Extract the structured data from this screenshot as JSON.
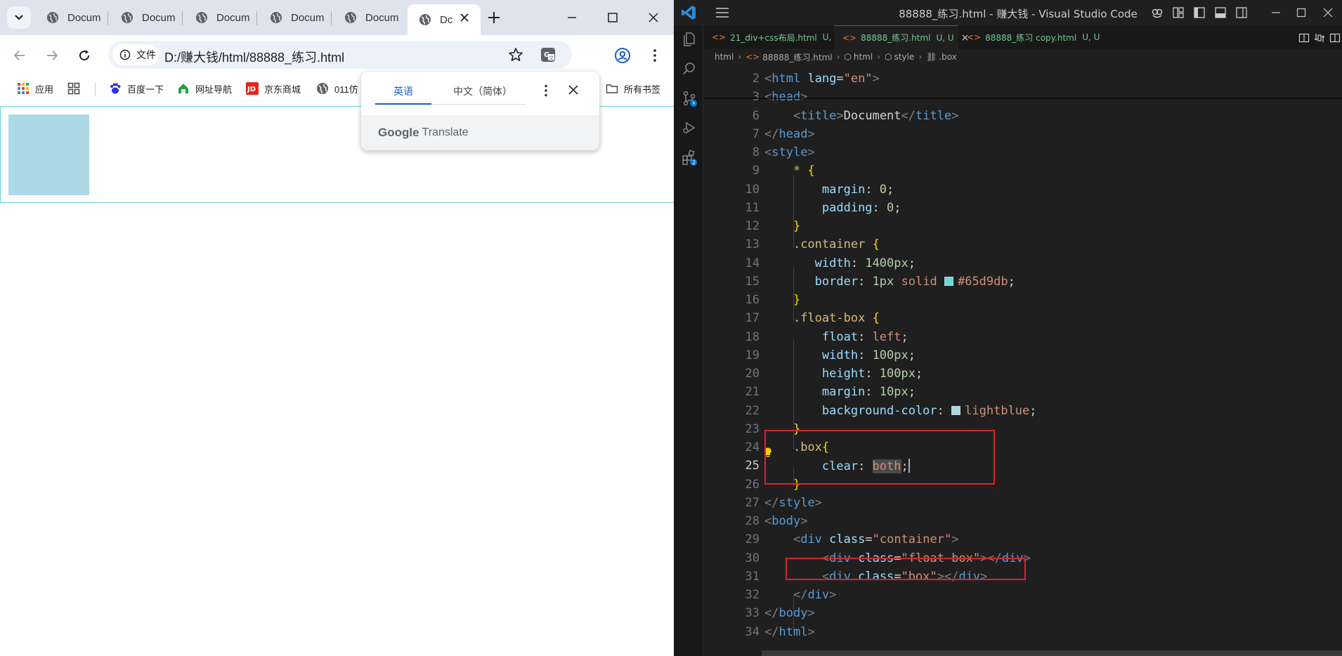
{
  "browser": {
    "tabs": [
      {
        "label": "Docum"
      },
      {
        "label": "Docum"
      },
      {
        "label": "Docum"
      },
      {
        "label": "Docum"
      },
      {
        "label": "Docum"
      },
      {
        "label": "Dc",
        "active": true
      }
    ],
    "address": {
      "chip_label": "文件",
      "url": "D:/赚大钱/html/88888_练习.html"
    },
    "bookmarks": [
      {
        "label": "应用",
        "icon": "apps-grid-icon"
      },
      {
        "label": "",
        "icon": "grid-icon"
      },
      {
        "label": "百度一下",
        "icon": "baidu-paw-icon"
      },
      {
        "label": "网址导航",
        "icon": "house-icon"
      },
      {
        "label": "京东商城",
        "icon": "jd-icon"
      },
      {
        "label": "011仿",
        "icon": "globe-icon"
      }
    ],
    "all_bookmarks": "所有书签",
    "translate_popup": {
      "tab_source": "英语",
      "tab_target": "中文（简体）",
      "brand": "Google",
      "product": "Translate"
    },
    "page": {
      "container_border_color": "#65d9db",
      "float_box_color": "#add8e6"
    }
  },
  "vscode": {
    "title": "88888_练习.html - 赚大钱 - Visual Studio Code",
    "tabs": [
      {
        "name": "21_div+css布局.html",
        "status": "U, U"
      },
      {
        "name": "88888_练习.html",
        "status": "U, U",
        "active": true
      },
      {
        "name": "88888_练习 copy.html",
        "status": "U, U"
      }
    ],
    "breadcrumb": [
      "html",
      "88888_练习.html",
      "html",
      "style",
      ".box"
    ],
    "activity_badge": "2",
    "current_line": 25,
    "lines": [
      {
        "n": 2,
        "tokens": [
          [
            "br",
            "<"
          ],
          [
            "tag",
            "html"
          ],
          [
            "txt",
            " "
          ],
          [
            "attr",
            "lang"
          ],
          [
            "punc",
            "="
          ],
          [
            "str",
            "\"en\""
          ],
          [
            "br",
            ">"
          ]
        ]
      },
      {
        "n": 3,
        "tokens": [
          [
            "br",
            "<"
          ],
          [
            "tag",
            "head"
          ],
          [
            "br",
            ">"
          ]
        ]
      },
      {
        "n": 6,
        "tokens": [
          [
            "txt",
            "    "
          ],
          [
            "br",
            "<"
          ],
          [
            "tag",
            "title"
          ],
          [
            "br",
            ">"
          ],
          [
            "txt",
            "Document"
          ],
          [
            "br",
            "</"
          ],
          [
            "tag",
            "title"
          ],
          [
            "br",
            ">"
          ]
        ]
      },
      {
        "n": 7,
        "tokens": [
          [
            "br",
            "</"
          ],
          [
            "tag",
            "head"
          ],
          [
            "br",
            ">"
          ]
        ]
      },
      {
        "n": 8,
        "tokens": [
          [
            "br",
            "<"
          ],
          [
            "tag",
            "style"
          ],
          [
            "br",
            ">"
          ]
        ]
      },
      {
        "n": 9,
        "tokens": [
          [
            "txt",
            "    "
          ],
          [
            "sel",
            "*"
          ],
          [
            "txt",
            " "
          ],
          [
            "brace",
            "{"
          ]
        ]
      },
      {
        "n": 10,
        "tokens": [
          [
            "txt",
            "        "
          ],
          [
            "prop",
            "margin"
          ],
          [
            "punc",
            ": "
          ],
          [
            "num",
            "0"
          ],
          [
            "punc",
            ";"
          ]
        ]
      },
      {
        "n": 11,
        "tokens": [
          [
            "txt",
            "        "
          ],
          [
            "prop",
            "padding"
          ],
          [
            "punc",
            ": "
          ],
          [
            "num",
            "0"
          ],
          [
            "punc",
            ";"
          ]
        ]
      },
      {
        "n": 12,
        "tokens": [
          [
            "txt",
            "    "
          ],
          [
            "brace",
            "}"
          ]
        ]
      },
      {
        "n": 13,
        "tokens": [
          [
            "txt",
            "    "
          ],
          [
            "sel",
            ".container"
          ],
          [
            "txt",
            " "
          ],
          [
            "brace",
            "{"
          ]
        ]
      },
      {
        "n": 14,
        "tokens": [
          [
            "txt",
            "       "
          ],
          [
            "prop",
            "width"
          ],
          [
            "punc",
            ": "
          ],
          [
            "num",
            "1400px"
          ],
          [
            "punc",
            ";"
          ]
        ]
      },
      {
        "n": 15,
        "tokens": [
          [
            "txt",
            "       "
          ],
          [
            "prop",
            "border"
          ],
          [
            "punc",
            ": "
          ],
          [
            "num",
            "1px"
          ],
          [
            "txt",
            " "
          ],
          [
            "val",
            "solid"
          ],
          [
            "txt",
            " "
          ],
          [
            "swatch",
            "#65d9db"
          ],
          [
            "val",
            "#65d9db"
          ],
          [
            "punc",
            ";"
          ]
        ]
      },
      {
        "n": 16,
        "tokens": [
          [
            "txt",
            "    "
          ],
          [
            "brace",
            "}"
          ]
        ]
      },
      {
        "n": 17,
        "tokens": [
          [
            "txt",
            "    "
          ],
          [
            "sel",
            ".float-box"
          ],
          [
            "txt",
            " "
          ],
          [
            "brace",
            "{"
          ]
        ]
      },
      {
        "n": 18,
        "tokens": [
          [
            "txt",
            "        "
          ],
          [
            "prop",
            "float"
          ],
          [
            "punc",
            ": "
          ],
          [
            "val",
            "left"
          ],
          [
            "punc",
            ";"
          ]
        ]
      },
      {
        "n": 19,
        "tokens": [
          [
            "txt",
            "        "
          ],
          [
            "prop",
            "width"
          ],
          [
            "punc",
            ": "
          ],
          [
            "num",
            "100px"
          ],
          [
            "punc",
            ";"
          ]
        ]
      },
      {
        "n": 20,
        "tokens": [
          [
            "txt",
            "        "
          ],
          [
            "prop",
            "height"
          ],
          [
            "punc",
            ": "
          ],
          [
            "num",
            "100px"
          ],
          [
            "punc",
            ";"
          ]
        ]
      },
      {
        "n": 21,
        "tokens": [
          [
            "txt",
            "        "
          ],
          [
            "prop",
            "margin"
          ],
          [
            "punc",
            ": "
          ],
          [
            "num",
            "10px"
          ],
          [
            "punc",
            ";"
          ]
        ]
      },
      {
        "n": 22,
        "tokens": [
          [
            "txt",
            "        "
          ],
          [
            "prop",
            "background-color"
          ],
          [
            "punc",
            ": "
          ],
          [
            "swatch",
            "#add8e6"
          ],
          [
            "val",
            "lightblue"
          ],
          [
            "punc",
            ";"
          ]
        ]
      },
      {
        "n": 23,
        "tokens": [
          [
            "txt",
            "    "
          ],
          [
            "brace",
            "}"
          ]
        ]
      },
      {
        "n": 24,
        "tokens": [
          [
            "txt",
            "    "
          ],
          [
            "sel",
            ".box"
          ],
          [
            "brace",
            "{"
          ]
        ]
      },
      {
        "n": 25,
        "tokens": [
          [
            "txt",
            "        "
          ],
          [
            "prop",
            "clear"
          ],
          [
            "punc",
            ": "
          ],
          [
            "valsel",
            "both"
          ],
          [
            "punc",
            ";"
          ],
          [
            "cursor",
            ""
          ]
        ]
      },
      {
        "n": 26,
        "tokens": [
          [
            "txt",
            "    "
          ],
          [
            "brace",
            "}"
          ]
        ]
      },
      {
        "n": 27,
        "tokens": [
          [
            "br",
            "</"
          ],
          [
            "tag",
            "style"
          ],
          [
            "br",
            ">"
          ]
        ]
      },
      {
        "n": 28,
        "tokens": [
          [
            "br",
            "<"
          ],
          [
            "tag",
            "body"
          ],
          [
            "br",
            ">"
          ]
        ]
      },
      {
        "n": 29,
        "tokens": [
          [
            "txt",
            "    "
          ],
          [
            "br",
            "<"
          ],
          [
            "tag",
            "div"
          ],
          [
            "txt",
            " "
          ],
          [
            "attr",
            "class"
          ],
          [
            "punc",
            "="
          ],
          [
            "str",
            "\"container\""
          ],
          [
            "br",
            ">"
          ]
        ]
      },
      {
        "n": 30,
        "tokens": [
          [
            "txt",
            "        "
          ],
          [
            "br",
            "<"
          ],
          [
            "tag",
            "div"
          ],
          [
            "txt",
            " "
          ],
          [
            "attr",
            "class"
          ],
          [
            "punc",
            "="
          ],
          [
            "str",
            "\"float-box\""
          ],
          [
            "br",
            "></"
          ],
          [
            "tag",
            "div"
          ],
          [
            "br",
            ">"
          ]
        ]
      },
      {
        "n": 31,
        "tokens": [
          [
            "txt",
            "        "
          ],
          [
            "br",
            "<"
          ],
          [
            "tag",
            "div"
          ],
          [
            "txt",
            " "
          ],
          [
            "attr",
            "class"
          ],
          [
            "punc",
            "="
          ],
          [
            "str",
            "\"box\""
          ],
          [
            "br",
            "></"
          ],
          [
            "tag",
            "div"
          ],
          [
            "br",
            ">"
          ]
        ]
      },
      {
        "n": 32,
        "tokens": [
          [
            "txt",
            "    "
          ],
          [
            "br",
            "</"
          ],
          [
            "tag",
            "div"
          ],
          [
            "br",
            ">"
          ]
        ]
      },
      {
        "n": 33,
        "tokens": [
          [
            "br",
            "</"
          ],
          [
            "tag",
            "body"
          ],
          [
            "br",
            ">"
          ]
        ]
      },
      {
        "n": 34,
        "tokens": [
          [
            "br",
            "</"
          ],
          [
            "tag",
            "html"
          ],
          [
            "br",
            ">"
          ]
        ]
      }
    ]
  }
}
